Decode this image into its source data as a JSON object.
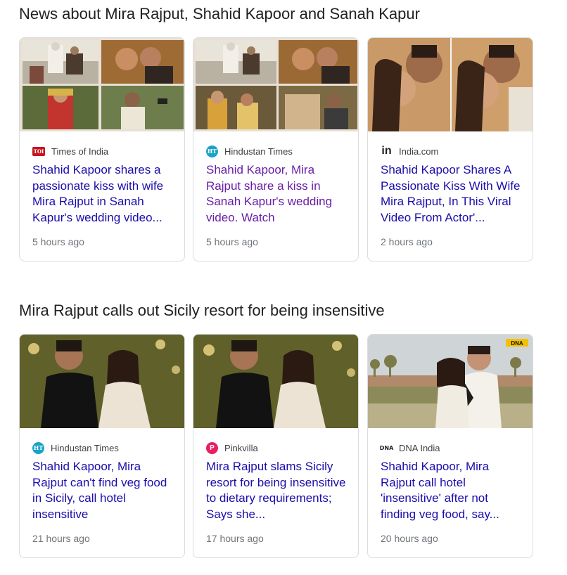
{
  "sections": [
    {
      "title": "News about Mira Rajput, Shahid Kapoor and Sanah Kapur",
      "cards": [
        {
          "source": "Times of India",
          "favicon_text": "TOI",
          "headline": "Shahid Kapoor shares a passionate kiss with wife Mira Rajput in Sanah Kapur's wedding video...",
          "time": "5 hours ago"
        },
        {
          "source": "Hindustan Times",
          "favicon_text": "HT",
          "headline": "Shahid Kapoor, Mira Rajput share a kiss in Sanah Kapur's wedding video. Watch",
          "time": "5 hours ago"
        },
        {
          "source": "India.com",
          "favicon_text": "in",
          "headline": "Shahid Kapoor Shares A Passionate Kiss With Wife Mira Rajput, In This Viral Video From Actor'...",
          "time": "2 hours ago"
        }
      ]
    },
    {
      "title": "Mira Rajput calls out Sicily resort for being insensitive",
      "cards": [
        {
          "source": "Hindustan Times",
          "favicon_text": "HT",
          "headline": "Shahid Kapoor, Mira Rajput can't find veg food in Sicily, call hotel insensitive",
          "time": "21 hours ago"
        },
        {
          "source": "Pinkvilla",
          "favicon_text": "P",
          "headline": "Mira Rajput slams Sicily resort for being insensitive to dietary requirements; Says she...",
          "time": "17 hours ago"
        },
        {
          "source": "DNA India",
          "favicon_text": "DNA",
          "headline": "Shahid Kapoor, Mira Rajput call hotel 'insensitive' after not finding veg food, say...",
          "time": "20 hours ago"
        }
      ]
    }
  ],
  "thumb_labels": {
    "dna_badge": "DNA"
  },
  "colors": {
    "link": "#1a0dab",
    "visited_link": "#681da8",
    "meta_text": "#70757a",
    "card_border": "#dadce0",
    "toi_red": "#c4161c",
    "ht_teal": "#19a3c6",
    "pinkvilla_pink": "#e91e63"
  }
}
